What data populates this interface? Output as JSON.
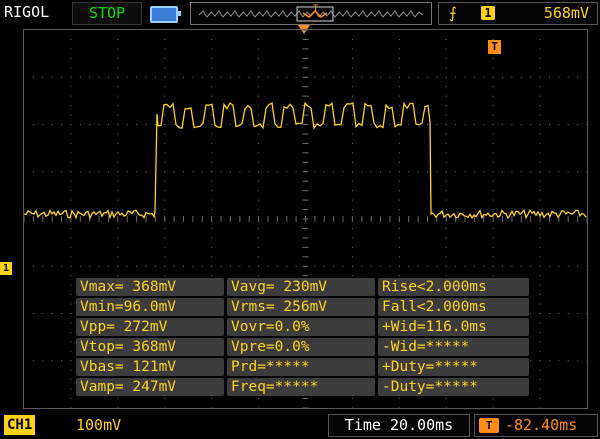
{
  "header": {
    "brand": "RIGOL",
    "status": "STOP",
    "trigger": {
      "edge_icon": "rising-edge-icon",
      "channel": "1",
      "level": "568mV"
    }
  },
  "markers": {
    "trigger_position": "T",
    "channel": "1"
  },
  "measurements": [
    [
      "Vmax= 368mV",
      "Vavg= 230mV",
      "Rise<2.000ms"
    ],
    [
      "Vmin=96.0mV",
      "Vrms= 256mV",
      "Fall<2.000ms"
    ],
    [
      "Vpp= 272mV",
      "Vovr=0.0%",
      "+Wid=116.0ms"
    ],
    [
      "Vtop= 368mV",
      "Vpre=0.0%",
      "-Wid=*****"
    ],
    [
      "Vbas= 121mV",
      "Prd=*****",
      "+Duty=*****"
    ],
    [
      "Vamp= 247mV",
      "Freq=*****",
      "-Duty=*****"
    ]
  ],
  "footer": {
    "channel_label": "CH1",
    "channel_scale": "100mV",
    "timebase": "Time 20.00ms",
    "trigger_offset_icon": "T",
    "trigger_offset": "-82.40ms"
  },
  "colors": {
    "channel1": "#ffd21a",
    "trigger": "#ff8c1a",
    "status": "#00e000"
  }
}
